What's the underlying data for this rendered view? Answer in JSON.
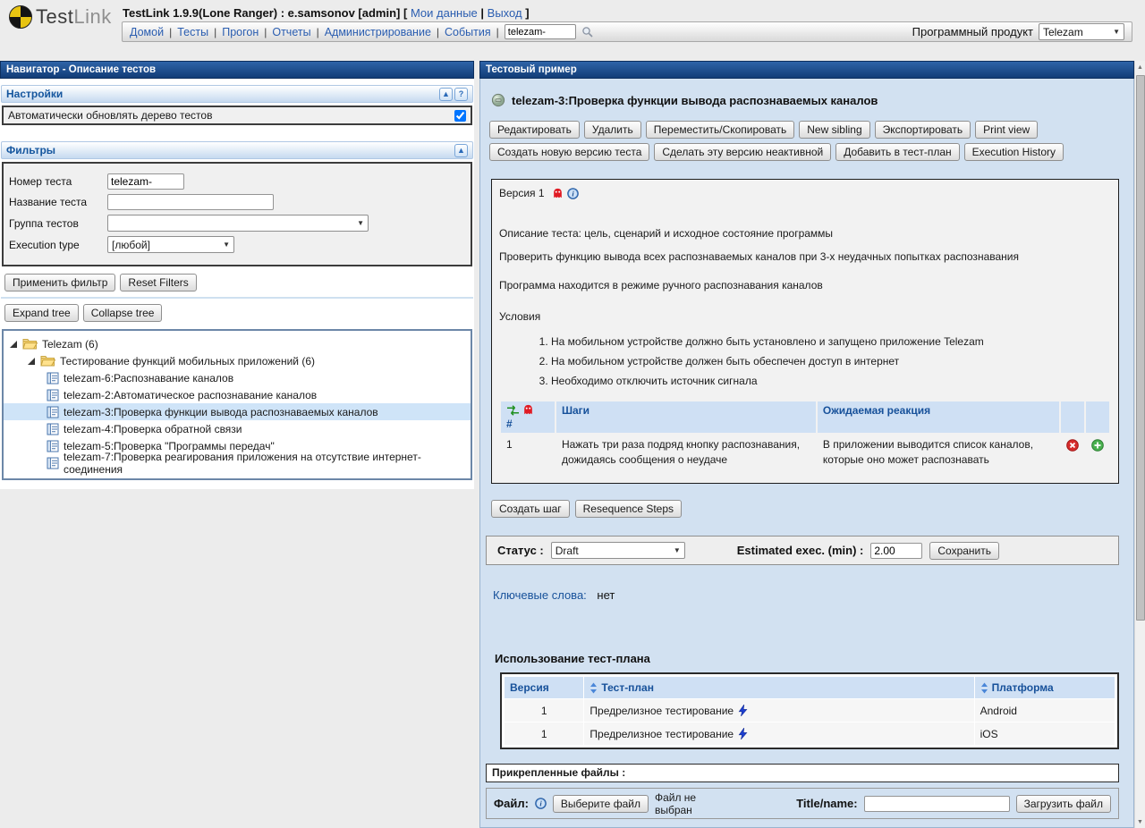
{
  "colors": {
    "title_bar": "#1d5194",
    "panel_bg": "#d2e1f1",
    "accent_blue": "#17519a",
    "ghost_red": "#e01b24",
    "table_header": "#cfe0f4"
  },
  "header": {
    "logo_part1": "Test",
    "logo_part2": "Link",
    "title_prefix": "TestLink 1.9.9(Lone Ranger) : e.samsonov [admin] [",
    "link_my_data": "Мои данные",
    "separator": "|",
    "link_logout": "Выход",
    "title_suffix": "]",
    "nav_items": [
      "Домой",
      "Тесты",
      "Прогон",
      "Отчеты",
      "Администрирование",
      "События"
    ],
    "search_value": "telezam-",
    "product_label": "Программный продукт",
    "product_value": "Telezam"
  },
  "left_panel": {
    "title": "Навигатор - Описание тестов",
    "settings": {
      "title": "Настройки",
      "collapse_glyph": "▲",
      "help_glyph": "?",
      "auto_update_label": "Автоматически обновлять дерево тестов"
    },
    "filters": {
      "title": "Фильтры",
      "collapse_glyph": "▲",
      "rows": [
        {
          "label": "Номер теста",
          "value": "telezam-"
        },
        {
          "label": "Название теста",
          "value": ""
        },
        {
          "label": "Группа тестов",
          "value": ""
        },
        {
          "label": "Execution type",
          "value": "[любой]"
        }
      ],
      "apply_button": "Применить фильтр",
      "reset_button": "Reset Filters"
    },
    "tree": {
      "expand_button": "Expand tree",
      "collapse_button": "Collapse tree",
      "root_label": "Telezam (6)",
      "suite_label": "Тестирование функций мобильных приложений (6)",
      "items": [
        {
          "label": "telezam-6:Распознавание каналов"
        },
        {
          "label": "telezam-2:Автоматическое распознавание каналов"
        },
        {
          "label": "telezam-3:Проверка функции вывода распознаваемых каналов"
        },
        {
          "label": "telezam-4:Проверка обратной связи"
        },
        {
          "label": "telezam-5:Проверка \"Программы передач\""
        },
        {
          "label": "telezam-7:Проверка реагирования приложения на отсутствие интернет-соединения"
        }
      ]
    }
  },
  "right_panel": {
    "title": "Тестовый пример",
    "test_case_title": "telezam-3:Проверка функции вывода распознаваемых каналов",
    "actions_row1": [
      "Редактировать",
      "Удалить",
      "Переместить/Скопировать",
      "New sibling",
      "Экспортировать",
      "Print view"
    ],
    "actions_row2": [
      "Создать новую версию теста",
      "Сделать эту версию неактивной",
      "Добавить в тест-план",
      "Execution History"
    ],
    "version": {
      "label": "Версия 1",
      "summary_heading": "Описание теста: цель, сценарий и исходное состояние программы",
      "summary_line1": "Проверить функцию вывода всех распознаваемых каналов при 3-х неудачных попытках распознавания",
      "summary_line2": "Программа находится в режиме ручного распознавания каналов",
      "preconditions_heading": "Условия",
      "preconditions": [
        "На мобильном устройстве должно быть установлено и запущено приложение Telezam",
        "На мобильном устройстве должен быть обеспечен доступ в интернет",
        "Необходимо отключить источник сигнала"
      ]
    },
    "steps_table": {
      "col_number": "#",
      "col_steps": "Шаги",
      "col_expected": "Ожидаемая реакция",
      "rows": [
        {
          "num": "1",
          "step": "Нажать три раза подряд кнопку распознавания, дожидаясь сообщения о неудаче",
          "expected": "В приложении выводится список каналов, которые оно может распознавать"
        }
      ]
    },
    "step_buttons": {
      "create": "Создать шаг",
      "resequence": "Resequence Steps"
    },
    "status_bar": {
      "status_label": "Статус :",
      "status_value": "Draft",
      "exec_label": "Estimated exec. (min) :",
      "exec_value": "2.00",
      "save_button": "Сохранить"
    },
    "keywords": {
      "label": "Ключевые слова:",
      "value": "нет"
    },
    "testplan_usage": {
      "title": "Использование тест-плана",
      "col_version": "Версия",
      "col_plan": "Тест-план",
      "col_platform": "Платформа",
      "rows": [
        {
          "version": "1",
          "plan": "Предрелизное тестирование",
          "platform": "Android"
        },
        {
          "version": "1",
          "plan": "Предрелизное тестирование",
          "platform": "iOS"
        }
      ]
    },
    "attachments": {
      "title": "Прикрепленные файлы :",
      "file_label": "Файл:",
      "choose_button": "Выберите файл",
      "no_file_text": "Файл не выбран",
      "name_label": "Title/name:",
      "upload_button": "Загрузить файл"
    }
  }
}
